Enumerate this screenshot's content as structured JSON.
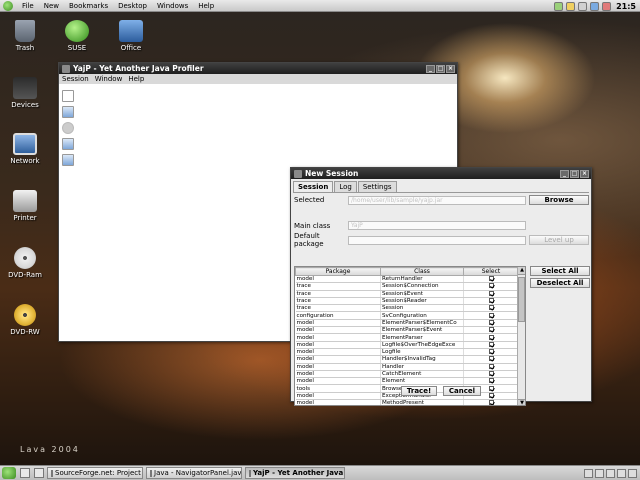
{
  "top_panel": {
    "menus": [
      "File",
      "New",
      "Bookmarks",
      "Desktop",
      "Windows",
      "Help"
    ],
    "clock": "21:5"
  },
  "desktop": {
    "icons": [
      {
        "label": "Trash"
      },
      {
        "label": "SUSE"
      },
      {
        "label": "Office"
      },
      {
        "label": "Devices"
      },
      {
        "label": "Network"
      },
      {
        "label": "Printer"
      },
      {
        "label": "DVD-Ram"
      },
      {
        "label": "DVD-RW"
      }
    ],
    "wallpaper_label": "Lava 2004"
  },
  "yajp_window": {
    "title": "YajP - Yet Another Java Profiler",
    "menus": [
      "Session",
      "Window",
      "Help"
    ]
  },
  "new_session": {
    "title": "New Session",
    "tabs": [
      "Session",
      "Log",
      "Settings"
    ],
    "selected_label": "Selected",
    "selected_placeholder": "/home/user/lib/sample/yajp.jar",
    "browse_label": "Browse",
    "main_class_label": "Main class",
    "main_class_value": "YajP",
    "default_package_label": "Default package",
    "level_up_label": "Level up",
    "select_all_label": "Select All",
    "deselect_all_label": "Deselect All",
    "trace_label": "Trace!",
    "cancel_label": "Cancel",
    "table": {
      "headers": [
        "Package",
        "Class",
        "Select"
      ],
      "rows": [
        [
          "model",
          "ReturnHandler",
          true
        ],
        [
          "trace",
          "Session$Connection",
          true
        ],
        [
          "trace",
          "Session$Event",
          true
        ],
        [
          "trace",
          "Session$Reader",
          true
        ],
        [
          "trace",
          "Session",
          true
        ],
        [
          "configuration",
          "SvConfiguration",
          true
        ],
        [
          "model",
          "ElementParser$ElementCo",
          true
        ],
        [
          "model",
          "ElementParser$Event",
          true
        ],
        [
          "model",
          "ElementParser",
          true
        ],
        [
          "model",
          "Logfile$OverTheEdgeExce",
          true
        ],
        [
          "model",
          "Logfile",
          true
        ],
        [
          "model",
          "Handler$InvalidTag",
          true
        ],
        [
          "model",
          "Handler",
          true
        ],
        [
          "model",
          "CatchElement",
          true
        ],
        [
          "model",
          "Element",
          true
        ],
        [
          "tools",
          "Browser",
          true
        ],
        [
          "model",
          "ExceptionHandler",
          true
        ],
        [
          "model",
          "MethodPresent",
          true
        ]
      ]
    }
  },
  "taskbar": {
    "tasks": [
      {
        "label": "SourceForge.net: Project I",
        "active": false
      },
      {
        "label": "Java - NavigatorPanel.java",
        "active": false
      },
      {
        "label": "YajP - Yet Another Java",
        "active": true
      }
    ]
  }
}
